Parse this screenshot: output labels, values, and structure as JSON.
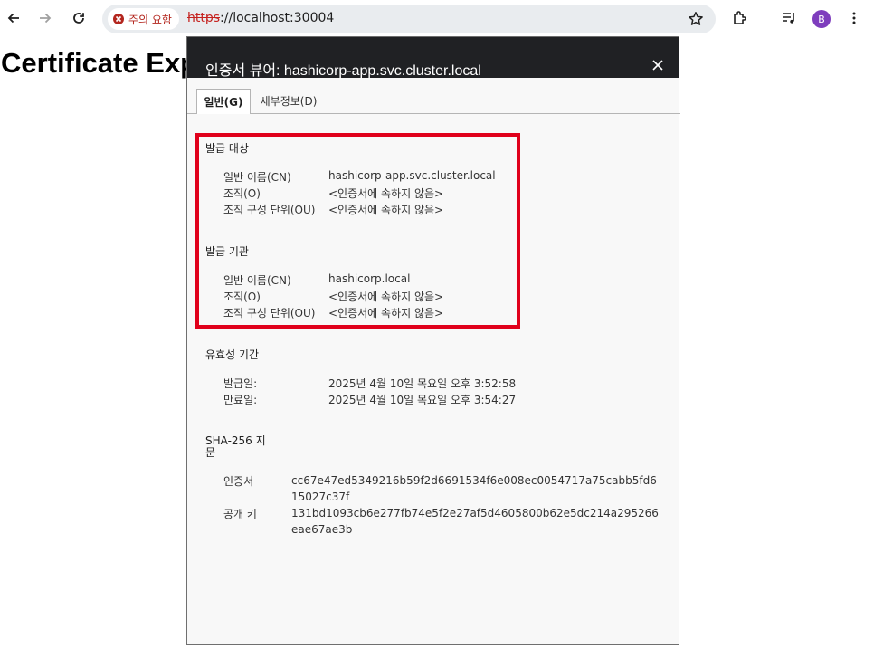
{
  "browser": {
    "security_chip": "주의 요함",
    "url_scheme": "https",
    "url_rest": "://localhost:30004",
    "avatar_letter": "B"
  },
  "page": {
    "heading": "Certificate Exp"
  },
  "dialog": {
    "title": "인증서 뷰어: hashicorp-app.svc.cluster.local",
    "tabs": [
      {
        "label": "일반(G)"
      },
      {
        "label": "세부정보(D)"
      }
    ],
    "issued_to": {
      "title": "발급 대상",
      "rows": [
        {
          "label": "일반 이름(CN)",
          "value": "hashicorp-app.svc.cluster.local"
        },
        {
          "label": "조직(O)",
          "value": "<인증서에 속하지 않음>"
        },
        {
          "label": "조직 구성 단위(OU)",
          "value": "<인증서에 속하지 않음>"
        }
      ]
    },
    "issued_by": {
      "title": "발급 기관",
      "rows": [
        {
          "label": "일반 이름(CN)",
          "value": "hashicorp.local"
        },
        {
          "label": "조직(O)",
          "value": "<인증서에 속하지 않음>"
        },
        {
          "label": "조직 구성 단위(OU)",
          "value": "<인증서에 속하지 않음>"
        }
      ]
    },
    "validity": {
      "title": "유효성 기간",
      "rows": [
        {
          "label": "발급일:",
          "value": "2025년 4월 10일 목요일 오후 3:52:58"
        },
        {
          "label": "만료일:",
          "value": "2025년 4월 10일 목요일 오후 3:54:27"
        }
      ]
    },
    "fingerprints": {
      "title_line1": "SHA-256 지",
      "title_line2": "문",
      "rows": [
        {
          "label": "인증서",
          "value": "cc67e47ed5349216b59f2d6691534f6e008ec0054717a75cabb5fd615027c37f"
        },
        {
          "label": "공개 키",
          "value": "131bd1093cb6e277fb74e5f2e27af5d4605800b62e5dc214a295266eae67ae3b"
        }
      ]
    }
  },
  "colors": {
    "highlight": "#e0001b",
    "dialog_header": "#202124",
    "danger": "#b3261e"
  }
}
